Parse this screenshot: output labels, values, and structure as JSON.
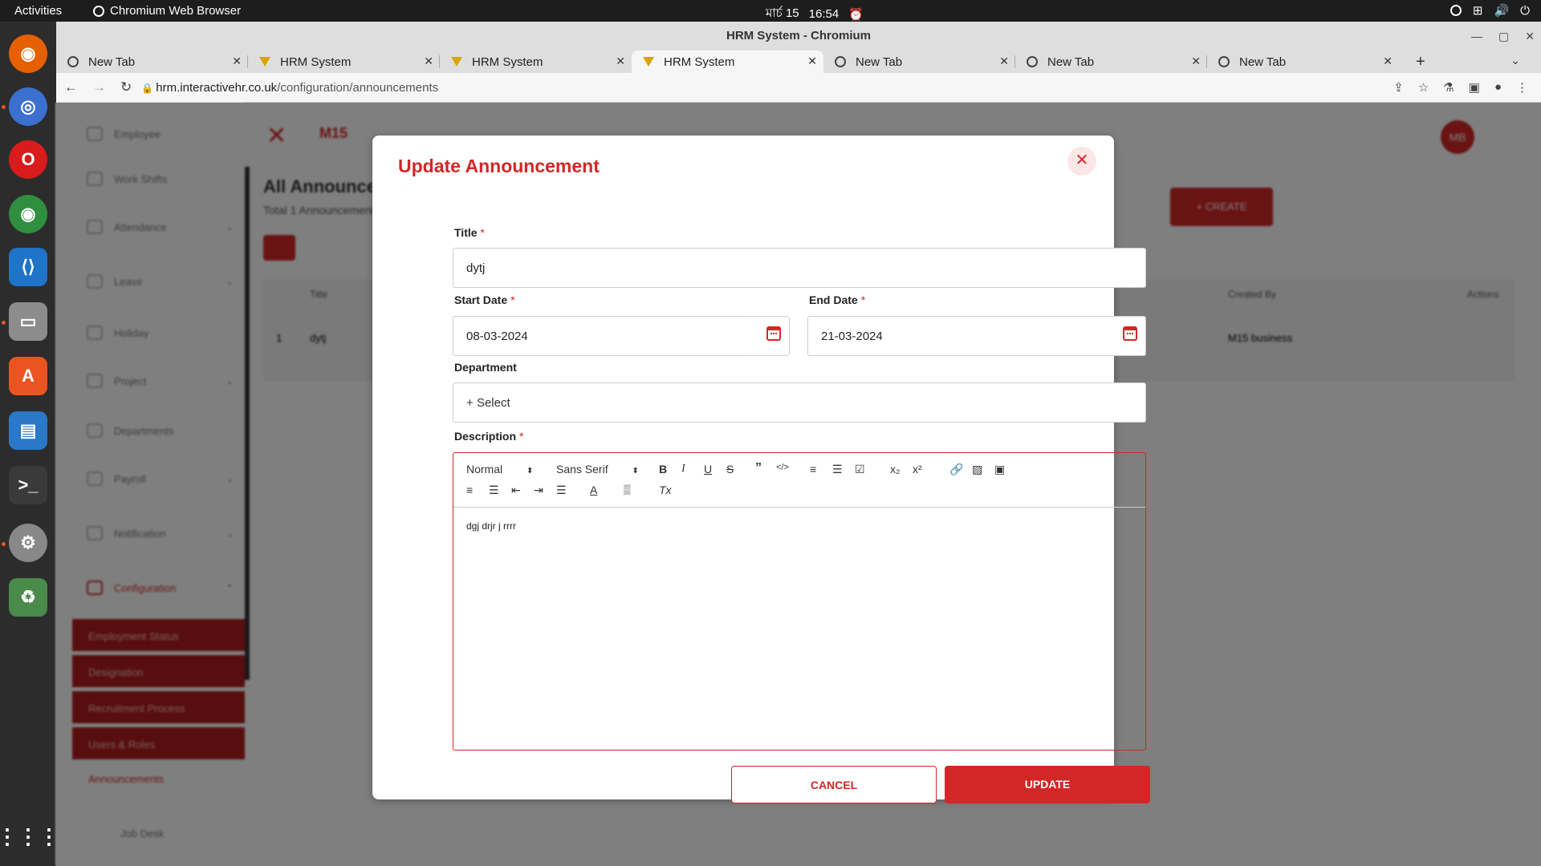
{
  "os": {
    "activities": "Activities",
    "app_name": "Chromium Web Browser",
    "date": "মার্চ 15",
    "time": "16:54"
  },
  "browser": {
    "window_title": "HRM System - Chromium",
    "tabs": [
      {
        "label": "New Tab",
        "icon": "chrome-icon"
      },
      {
        "label": "HRM System",
        "icon": "hrm-icon"
      },
      {
        "label": "HRM System",
        "icon": "hrm-icon"
      },
      {
        "label": "HRM System",
        "icon": "hrm-icon",
        "active": true
      },
      {
        "label": "New Tab",
        "icon": "chrome-icon"
      },
      {
        "label": "New Tab",
        "icon": "chrome-icon"
      },
      {
        "label": "New Tab",
        "icon": "chrome-icon"
      }
    ],
    "url_host": "hrm.interactivehr.co.uk",
    "url_path": "/configuration/announcements"
  },
  "background_page": {
    "brand": "M15",
    "heading": "All Announcements",
    "subheading": "Total 1 Announcement Found",
    "create_label": "+ CREATE",
    "avatar": "MB",
    "table_headers": [
      "Title",
      "Created By",
      "Actions"
    ],
    "row": {
      "index": "1",
      "title": "dytj",
      "created_by": "M15 business"
    },
    "sidebar": [
      "Employee",
      "Work Shifts",
      "Attendance",
      "Leave",
      "Holiday",
      "Project",
      "Departments",
      "Payroll",
      "Notification",
      "Configuration"
    ],
    "sidebar_sub": [
      "Employment Status",
      "Designation",
      "Recruitment Process",
      "Users & Roles",
      "Announcements",
      "Job Desk"
    ]
  },
  "modal": {
    "title": "Update Announcement",
    "title_label": "Title",
    "title_value": "dytj",
    "start_label": "Start Date",
    "start_value": "08-03-2024",
    "end_label": "End Date",
    "end_value": "21-03-2024",
    "department_label": "Department",
    "department_placeholder": "Select",
    "description_label": "Description",
    "toolbar": {
      "heading": "Normal",
      "font": "Sans Serif"
    },
    "description_text": "dgj drjr j rrrr",
    "cancel_label": "CANCEL",
    "update_label": "UPDATE",
    "accent": "#d32626"
  }
}
